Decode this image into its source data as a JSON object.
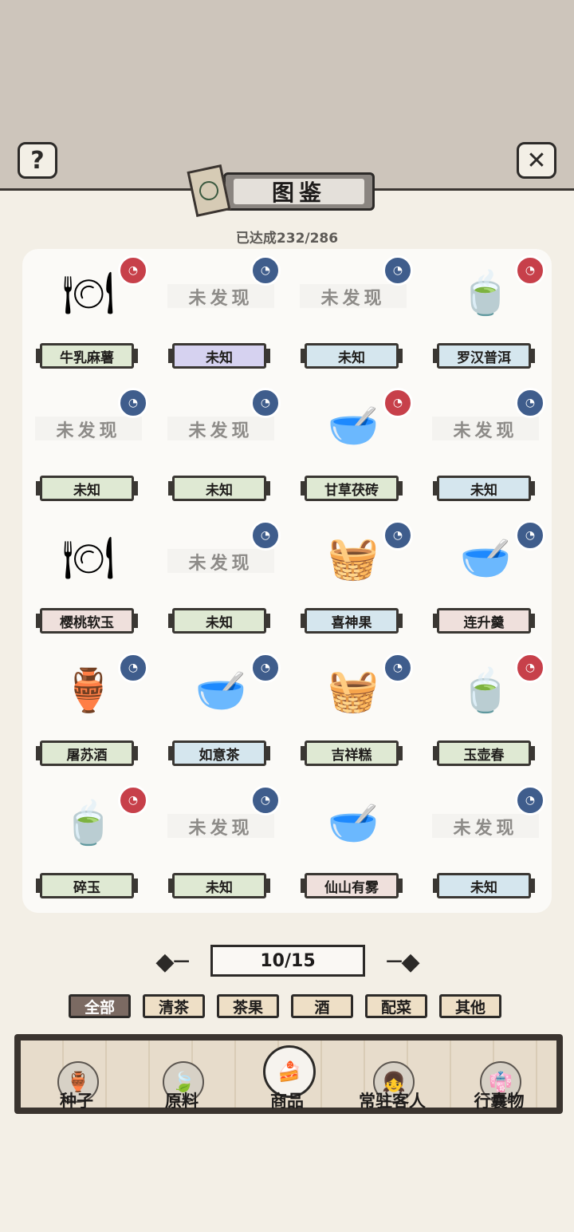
{
  "header": {
    "help_icon": "question-icon",
    "close_icon": "close-x-icon",
    "title": "图鉴",
    "progress": "已达成232/286"
  },
  "grid": [
    {
      "name": "牛乳麻薯",
      "discovered": true,
      "label_color": "green",
      "badge": "red",
      "art": "plate"
    },
    {
      "name": "未知",
      "discovered": false,
      "undiscovered_text": "未发现",
      "label_color": "purple",
      "badge": "blue"
    },
    {
      "name": "未知",
      "discovered": false,
      "undiscovered_text": "未发现",
      "label_color": "blue",
      "badge": "blue"
    },
    {
      "name": "罗汉普洱",
      "discovered": true,
      "label_color": "blue",
      "badge": "red",
      "art": "teacup"
    },
    {
      "name": "未知",
      "discovered": false,
      "undiscovered_text": "未发现",
      "label_color": "green",
      "badge": "blue"
    },
    {
      "name": "未知",
      "discovered": false,
      "undiscovered_text": "未发现",
      "label_color": "green",
      "badge": "blue"
    },
    {
      "name": "甘草茯砖",
      "discovered": true,
      "label_color": "green",
      "badge": "red",
      "art": "bowl"
    },
    {
      "name": "未知",
      "discovered": false,
      "undiscovered_text": "未发现",
      "label_color": "blue",
      "badge": "blue"
    },
    {
      "name": "樱桃软玉",
      "discovered": true,
      "label_color": "pink",
      "badge": "none",
      "art": "plate"
    },
    {
      "name": "未知",
      "discovered": false,
      "undiscovered_text": "未发现",
      "label_color": "green",
      "badge": "blue"
    },
    {
      "name": "喜神果",
      "discovered": true,
      "label_color": "blue",
      "badge": "blue",
      "art": "tray"
    },
    {
      "name": "连升羹",
      "discovered": true,
      "label_color": "pink",
      "badge": "blue",
      "art": "small-bowl"
    },
    {
      "name": "屠苏酒",
      "discovered": true,
      "label_color": "green",
      "badge": "blue",
      "art": "vessel"
    },
    {
      "name": "如意茶",
      "discovered": true,
      "label_color": "blue",
      "badge": "blue",
      "art": "bowl"
    },
    {
      "name": "吉祥糕",
      "discovered": true,
      "label_color": "green",
      "badge": "blue",
      "art": "tray"
    },
    {
      "name": "玉壶春",
      "discovered": true,
      "label_color": "green",
      "badge": "red",
      "art": "teacup"
    },
    {
      "name": "碎玉",
      "discovered": true,
      "label_color": "green",
      "badge": "red",
      "art": "teacup"
    },
    {
      "name": "未知",
      "discovered": false,
      "undiscovered_text": "未发现",
      "label_color": "green",
      "badge": "blue"
    },
    {
      "name": "仙山有雾",
      "discovered": true,
      "label_color": "pink",
      "badge": "none",
      "art": "bowl"
    },
    {
      "name": "未知",
      "discovered": false,
      "undiscovered_text": "未发现",
      "label_color": "blue",
      "badge": "blue"
    }
  ],
  "pager": {
    "text": "10/15",
    "prev_icon": "arrow-left-icon",
    "next_icon": "arrow-right-icon"
  },
  "filters": [
    {
      "label": "全部",
      "active": true
    },
    {
      "label": "清茶",
      "active": false
    },
    {
      "label": "茶果",
      "active": false
    },
    {
      "label": "酒",
      "active": false
    },
    {
      "label": "配菜",
      "active": false
    },
    {
      "label": "其他",
      "active": false
    }
  ],
  "bottom_nav": [
    {
      "label": "种子",
      "icon": "jar-icon",
      "active": false
    },
    {
      "label": "原料",
      "icon": "leaf-icon",
      "active": false
    },
    {
      "label": "商品",
      "icon": "cake-icon",
      "active": true
    },
    {
      "label": "常驻客人",
      "icon": "girl-icon",
      "active": false
    },
    {
      "label": "行囊物",
      "icon": "robe-icon",
      "active": false
    }
  ],
  "colors": {
    "top_band": "#cdc5bb",
    "page_bg": "#f3efe6",
    "panel_bg": "#fbfaf7",
    "badge_blue": "#3f5d8c",
    "badge_red": "#c7404a",
    "filter_active": "#7b6a62"
  }
}
